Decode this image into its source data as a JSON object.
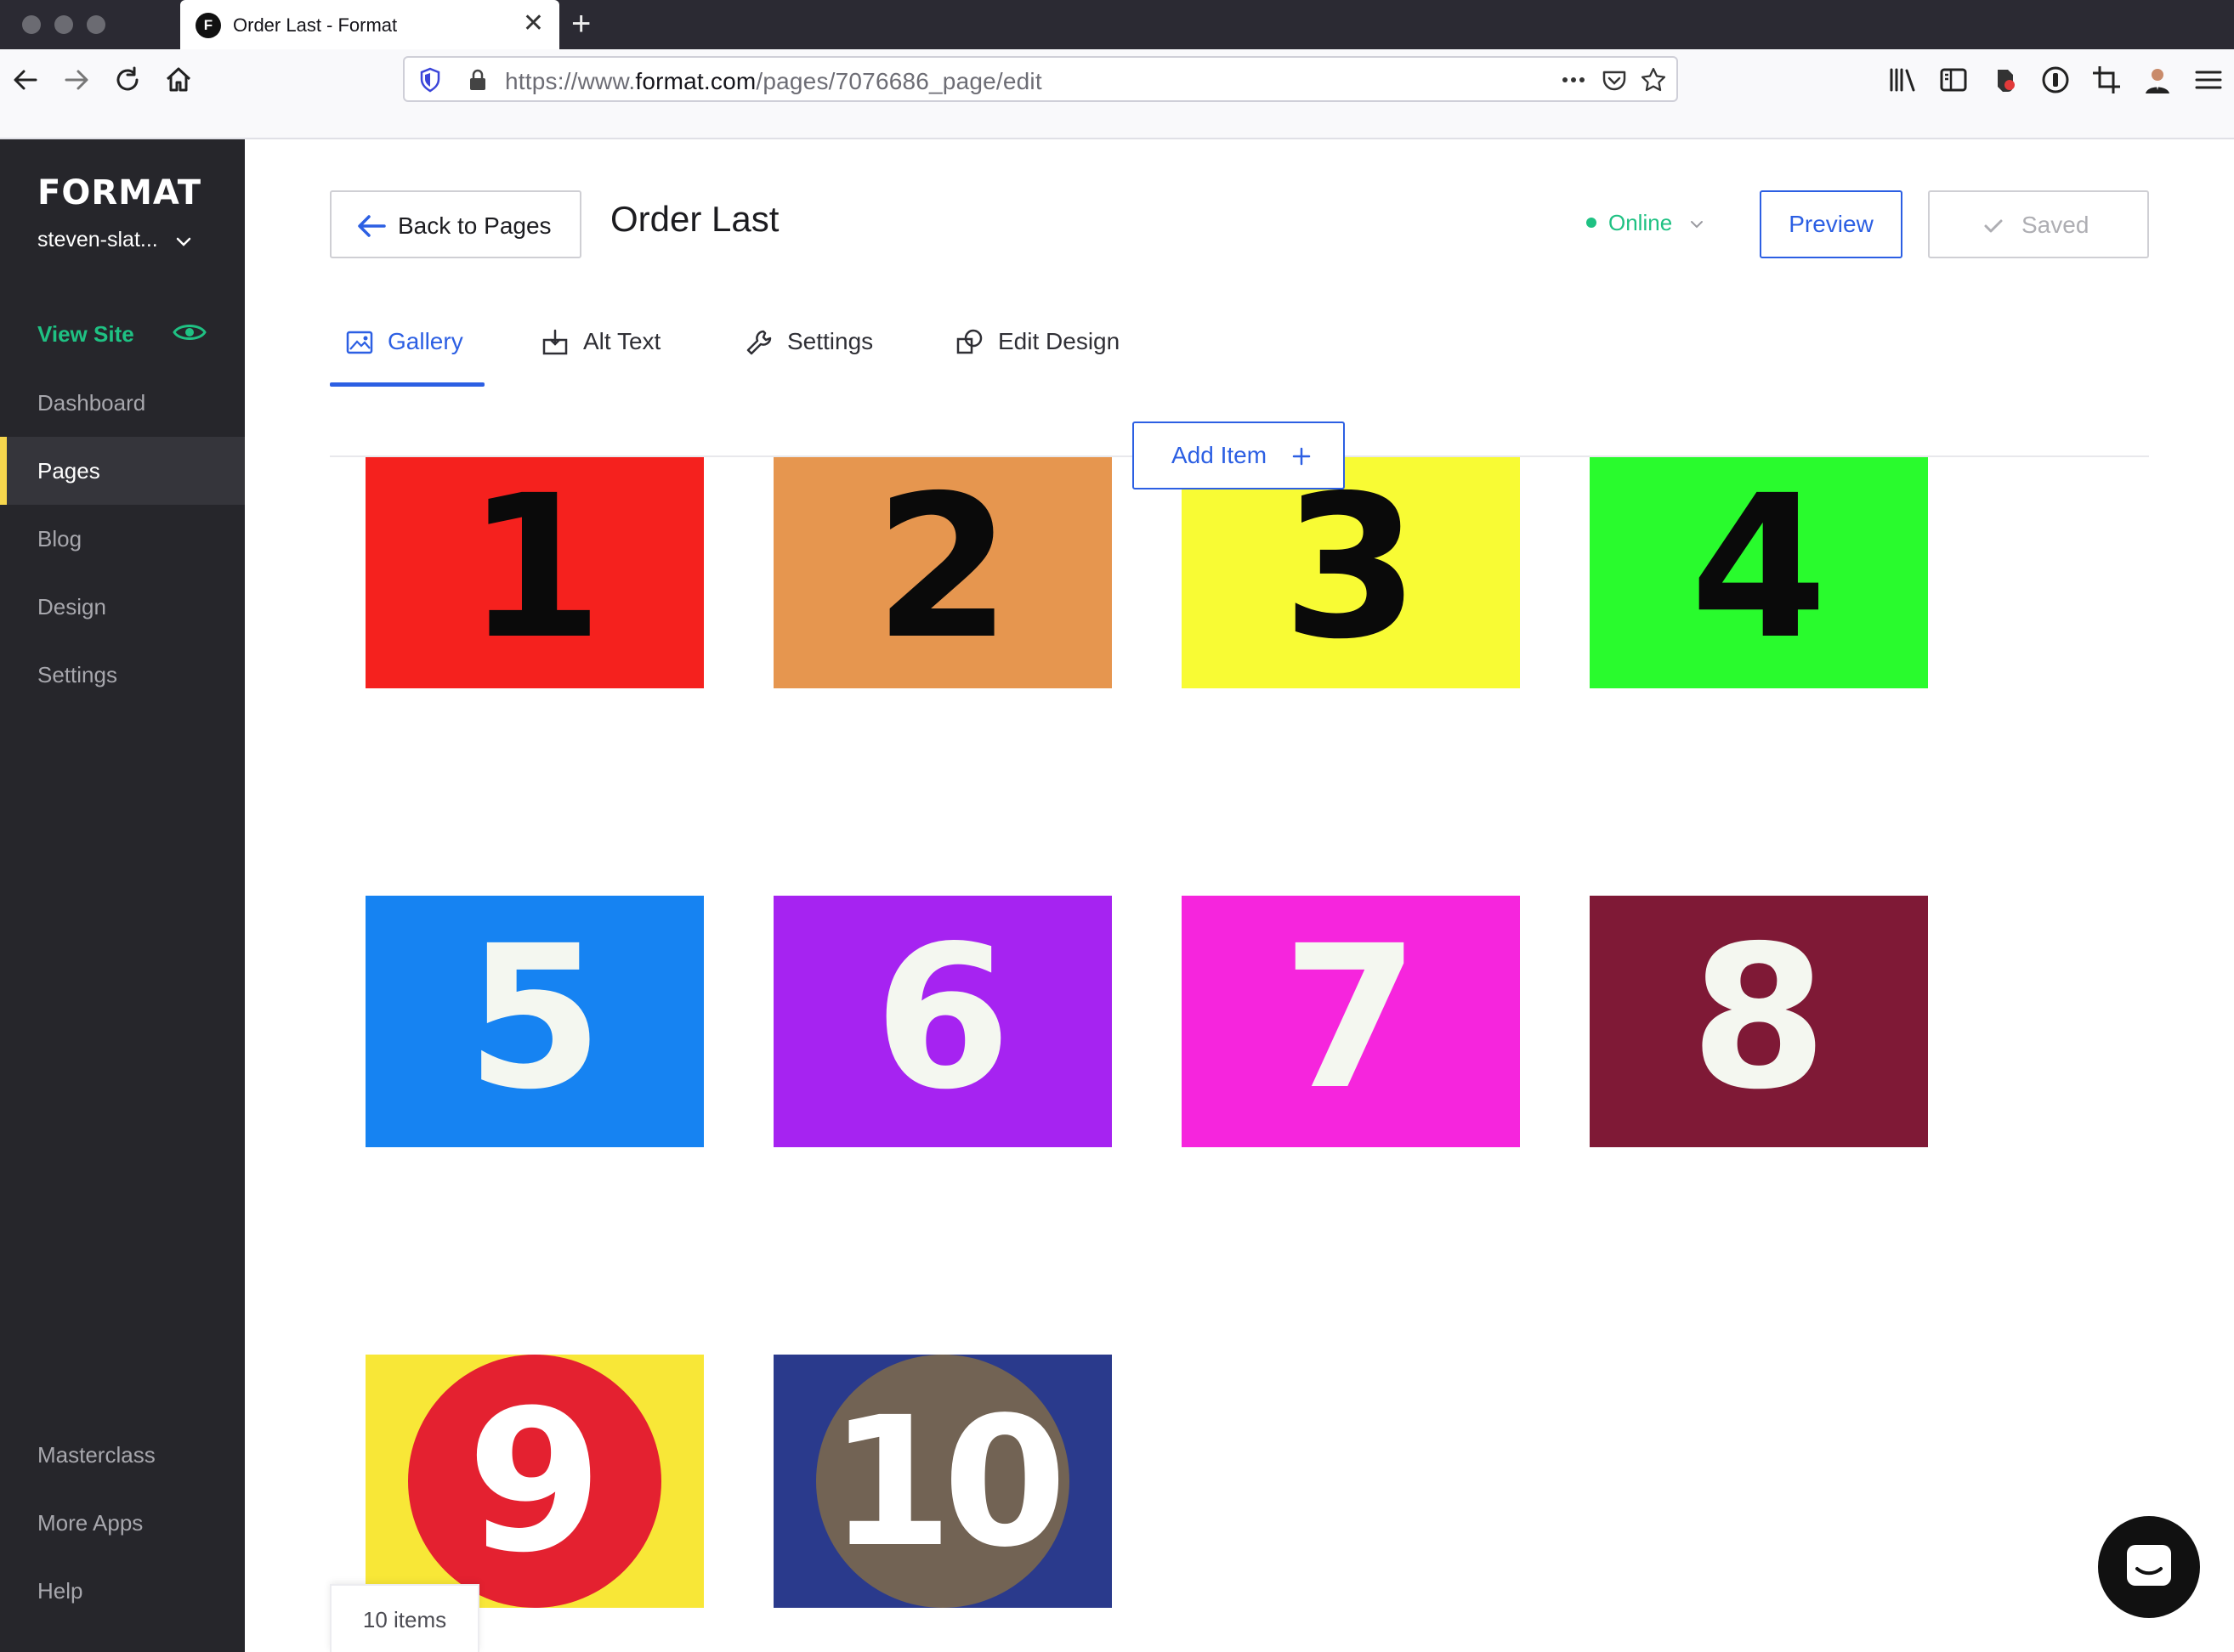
{
  "browser": {
    "tab_title": "Order Last - Format",
    "tab_favicon_letter": "F",
    "url_prefix": "https://www.",
    "url_domain": "format.com",
    "url_path": "/pages/7076686_page/edit"
  },
  "sidebar": {
    "logo": "FORMAT",
    "account": "steven-slat...",
    "view_site": "View Site",
    "items": [
      {
        "label": "Dashboard"
      },
      {
        "label": "Pages",
        "active": true
      },
      {
        "label": "Blog"
      },
      {
        "label": "Design"
      },
      {
        "label": "Settings"
      }
    ],
    "footer_items": [
      {
        "label": "Masterclass"
      },
      {
        "label": "More Apps"
      },
      {
        "label": "Help"
      }
    ]
  },
  "header": {
    "back_label": "Back to Pages",
    "page_title": "Order Last",
    "status": "Online",
    "preview_label": "Preview",
    "saved_label": "Saved"
  },
  "tabs": [
    {
      "label": "Gallery",
      "icon": "image-icon",
      "active": true
    },
    {
      "label": "Alt Text",
      "icon": "alt-text-icon"
    },
    {
      "label": "Settings",
      "icon": "wrench-icon"
    },
    {
      "label": "Edit Design",
      "icon": "shapes-icon"
    }
  ],
  "add_item_label": "Add Item",
  "gallery": {
    "items": [
      {
        "number": "1",
        "bg": "#f5211e",
        "fg": "#0a0a0a"
      },
      {
        "number": "2",
        "bg": "#e6964f",
        "fg": "#0a0a0a"
      },
      {
        "number": "3",
        "bg": "#f8fb34",
        "fg": "#0a0a0a"
      },
      {
        "number": "4",
        "bg": "#29fb2d",
        "fg": "#0a0a0a"
      },
      {
        "number": "5",
        "bg": "#1683f2",
        "fg": "#f4f7f0"
      },
      {
        "number": "6",
        "bg": "#a623f1",
        "fg": "#f4f7f0"
      },
      {
        "number": "7",
        "bg": "#f625dd",
        "fg": "#f4f7f0"
      },
      {
        "number": "8",
        "bg": "#7f1936",
        "fg": "#f4f7f0"
      },
      {
        "number": "9",
        "bg": "#f8e737",
        "fg": "#ffffff",
        "circle": "#e42130"
      },
      {
        "number": "10",
        "bg": "#2a3a8c",
        "fg": "#ffffff",
        "circle": "#726354"
      }
    ],
    "count_label": "10 items"
  },
  "colors": {
    "accent": "#2c5fe3",
    "online": "#1fc183",
    "sidebar_bg": "#26262b",
    "active_marker": "#f6d64d"
  }
}
